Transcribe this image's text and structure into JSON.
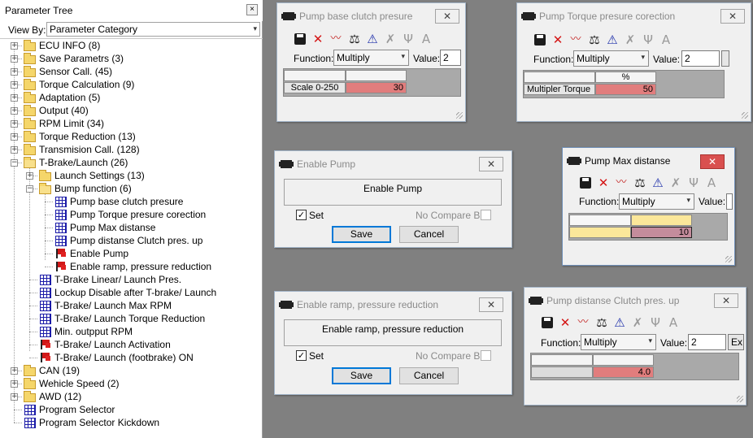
{
  "tree": {
    "title": "Parameter Tree",
    "close_glyph": "×",
    "view_by_label": "View By:",
    "view_by_value": "Parameter Category",
    "items": [
      {
        "label": "ECU INFO (8)",
        "type": "folder",
        "expander": "+"
      },
      {
        "label": "Save Parametrs (3)",
        "type": "folder",
        "expander": "+"
      },
      {
        "label": "Sensor Call. (45)",
        "type": "folder",
        "expander": "+"
      },
      {
        "label": "Torque Calculation (9)",
        "type": "folder",
        "expander": "+"
      },
      {
        "label": "Adaptation (5)",
        "type": "folder",
        "expander": "+"
      },
      {
        "label": "Output (40)",
        "type": "folder",
        "expander": "+"
      },
      {
        "label": "RPM Limit (34)",
        "type": "folder",
        "expander": "+"
      },
      {
        "label": "Torque Reduction (13)",
        "type": "folder",
        "expander": "+"
      },
      {
        "label": "Transmision Call. (128)",
        "type": "folder",
        "expander": "+"
      },
      {
        "label": "T-Brake/Launch (26)",
        "type": "folder-open",
        "expander": "−"
      },
      {
        "label": "Launch Settings (13)",
        "type": "folder",
        "expander": "+"
      },
      {
        "label": "Bump function (6)",
        "type": "folder-open",
        "expander": "−"
      },
      {
        "label": "Pump base clutch presure",
        "type": "table"
      },
      {
        "label": "Pump Torque presure corection",
        "type": "table"
      },
      {
        "label": "Pump Max distanse",
        "type": "table"
      },
      {
        "label": "Pump distanse Clutch pres. up",
        "type": "table"
      },
      {
        "label": "Enable Pump",
        "type": "flag"
      },
      {
        "label": "Enable ramp, pressure reduction",
        "type": "flag"
      },
      {
        "label": "T-Brake Linear/ Launch Pres.",
        "type": "table"
      },
      {
        "label": "Lockup  Disable after T-brake/ Launch",
        "type": "table"
      },
      {
        "label": "T-Brake/ Launch  Max RPM",
        "type": "table"
      },
      {
        "label": "T-Brake/ Launch  Torque Reduction",
        "type": "table"
      },
      {
        "label": "Min. outpput RPM",
        "type": "table"
      },
      {
        "label": "T-Brake/ Launch Activation",
        "type": "flag"
      },
      {
        "label": "T-Brake/ Launch (footbrake) ON",
        "type": "flag"
      },
      {
        "label": "CAN (19)",
        "type": "folder",
        "expander": "+"
      },
      {
        "label": "Wehicle Speed (2)",
        "type": "folder",
        "expander": "+"
      },
      {
        "label": "AWD (12)",
        "type": "folder",
        "expander": "+"
      },
      {
        "label": "Program Selector",
        "type": "table"
      },
      {
        "label": "Program Selector Kickdown",
        "type": "table"
      }
    ]
  },
  "toolbar_glyphs": {
    "cross": "✕",
    "chart": "〰",
    "scale": "⚖",
    "warn": "⚠",
    "spark": "✗",
    "branch": "Ψ",
    "font": "A"
  },
  "close_glyph": "✕",
  "chevron": "▾",
  "check_glyph": "✓",
  "windows": {
    "pump_base": {
      "title": "Pump base clutch presure",
      "function_label": "Function:",
      "function_value": "Multiply",
      "value_label": "Value:",
      "value_input": "2",
      "col_header": "",
      "row_label": "Scale 0-250",
      "cell_value": "30"
    },
    "pump_torque": {
      "title": "Pump Torque presure corection",
      "function_label": "Function:",
      "function_value": "Multiply",
      "value_label": "Value:",
      "value_input": "2",
      "col_header": "%",
      "row_label": "Multipler Torque",
      "cell_value": "50"
    },
    "enable_pump": {
      "title": "Enable Pump",
      "panel_text": "Enable Pump",
      "set_label": "Set",
      "compare_label": "No Compare Bin",
      "save_label": "Save",
      "cancel_label": "Cancel"
    },
    "pump_max": {
      "title": "Pump Max distanse",
      "function_label": "Function:",
      "function_value": "Multiply",
      "value_label": "Value:",
      "cell_value": "10"
    },
    "enable_ramp": {
      "title": "Enable ramp, pressure reduction",
      "panel_text": "Enable ramp, pressure reduction",
      "set_label": "Set",
      "compare_label": "No Compare Bin",
      "save_label": "Save",
      "cancel_label": "Cancel"
    },
    "pump_dist": {
      "title": "Pump distanse Clutch pres. up",
      "function_label": "Function:",
      "function_value": "Multiply",
      "value_label": "Value:",
      "value_input": "2",
      "extra_button": "Ex",
      "cell_value": "4.0"
    }
  }
}
